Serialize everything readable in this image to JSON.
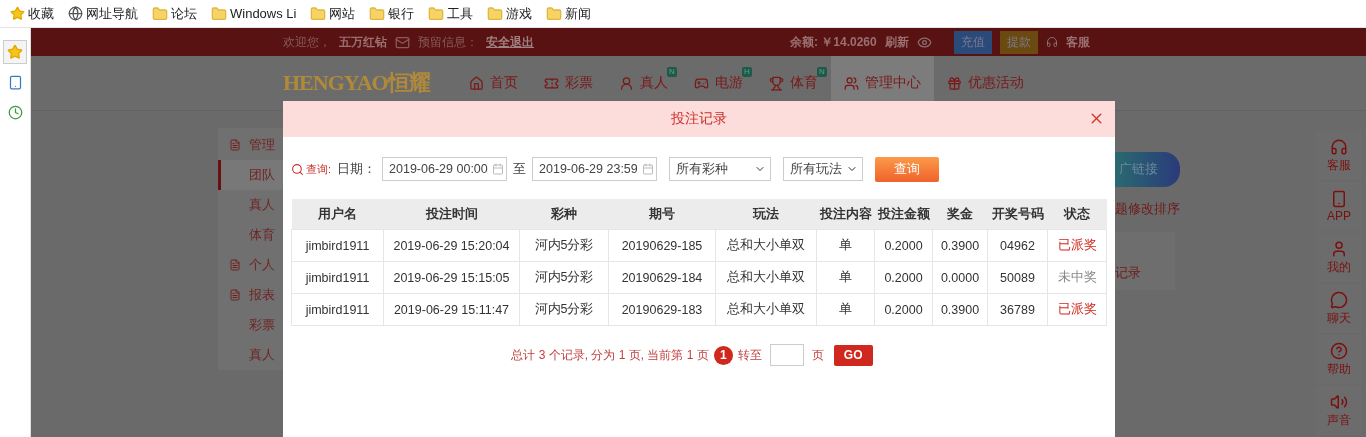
{
  "bookmarks": [
    {
      "label": "收藏",
      "kind": "star"
    },
    {
      "label": "网址导航",
      "kind": "globe"
    },
    {
      "label": "论坛",
      "kind": "folder"
    },
    {
      "label": "Windows Li",
      "kind": "folder"
    },
    {
      "label": "网站",
      "kind": "folder"
    },
    {
      "label": "银行",
      "kind": "folder"
    },
    {
      "label": "工具",
      "kind": "folder"
    },
    {
      "label": "游戏",
      "kind": "folder"
    },
    {
      "label": "新闻",
      "kind": "folder"
    }
  ],
  "side_tools": [
    {
      "kind": "star",
      "selected": true
    },
    {
      "kind": "tablet",
      "selected": false
    },
    {
      "kind": "clock",
      "selected": false
    }
  ],
  "top_bar": {
    "welcome": "欢迎您，",
    "user": "五万红钻",
    "notice_label": "预留信息：",
    "logout": "安全退出",
    "balance": "余额: ￥14.0260",
    "refresh": "刷新",
    "deposit": "充值",
    "withdraw": "提款",
    "service": "客服"
  },
  "logo": {
    "latin": "HENGYAO",
    "hanzi": "恒耀"
  },
  "nav": [
    {
      "label": "首页",
      "kind": "home",
      "selected": false
    },
    {
      "label": "彩票",
      "kind": "ticket",
      "selected": false
    },
    {
      "label": "真人",
      "kind": "person",
      "badge": "N",
      "selected": false
    },
    {
      "label": "电游",
      "kind": "game",
      "badge": "H",
      "selected": false
    },
    {
      "label": "体育",
      "kind": "trophy",
      "badge": "N",
      "selected": false
    },
    {
      "label": "管理中心",
      "kind": "users",
      "selected": true
    },
    {
      "label": "优惠活动",
      "kind": "gift",
      "selected": false
    }
  ],
  "side_menu": [
    {
      "label": "管理",
      "kind": "group",
      "selected": false
    },
    {
      "label": "团队",
      "kind": "item",
      "selected": true
    },
    {
      "label": "真人",
      "kind": "item",
      "selected": false
    },
    {
      "label": "体育",
      "kind": "item",
      "selected": false
    },
    {
      "label": "个人",
      "kind": "group",
      "selected": false
    },
    {
      "label": "报表",
      "kind": "group",
      "selected": false
    },
    {
      "label": "彩票",
      "kind": "item",
      "selected": false
    },
    {
      "label": "真人",
      "kind": "item",
      "selected": false
    }
  ],
  "right_panel": {
    "link_button": "广链接",
    "sort_note": "题修改排序",
    "records": "记录"
  },
  "float_tools": [
    {
      "label": "客服",
      "kind": "headset"
    },
    {
      "label": "APP",
      "kind": "phone"
    },
    {
      "label": "我的",
      "kind": "user"
    },
    {
      "label": "聊天",
      "kind": "chat"
    },
    {
      "label": "帮助",
      "kind": "help"
    },
    {
      "label": "声音",
      "kind": "sound"
    }
  ],
  "modal": {
    "title": "投注记录",
    "query_label": "查询:",
    "date_label": "日期：",
    "start_date": "2019-06-29 00:00",
    "to": "至",
    "end_date": "2019-06-29 23:59",
    "lottery_select": "所有彩种",
    "play_select": "所有玩法",
    "query_button": "查询",
    "table": {
      "columns": [
        "用户名",
        "投注时间",
        "彩种",
        "期号",
        "玩法",
        "投注内容",
        "投注金额",
        "奖金",
        "开奖号码",
        "状态"
      ],
      "rows": [
        {
          "cells": [
            "jimbird1911",
            "2019-06-29 15:20:04",
            "河内5分彩",
            "20190629-185",
            "总和大小单双",
            "单",
            "0.2000",
            "0.3900",
            "04962"
          ],
          "status": "已派奖",
          "won": true
        },
        {
          "cells": [
            "jimbird1911",
            "2019-06-29 15:15:05",
            "河内5分彩",
            "20190629-184",
            "总和大小单双",
            "单",
            "0.2000",
            "0.0000",
            "50089"
          ],
          "status": "未中奖",
          "won": false
        },
        {
          "cells": [
            "jimbird1911",
            "2019-06-29 15:11:47",
            "河内5分彩",
            "20190629-183",
            "总和大小单双",
            "单",
            "0.2000",
            "0.3900",
            "36789"
          ],
          "status": "已派奖",
          "won": true
        }
      ]
    },
    "pagination": {
      "summary": "总计 3 个记录, 分为 1 页, 当前第 1 页",
      "current_page": "1",
      "goto": "转至",
      "page_unit": "页",
      "go_button": "GO"
    }
  }
}
